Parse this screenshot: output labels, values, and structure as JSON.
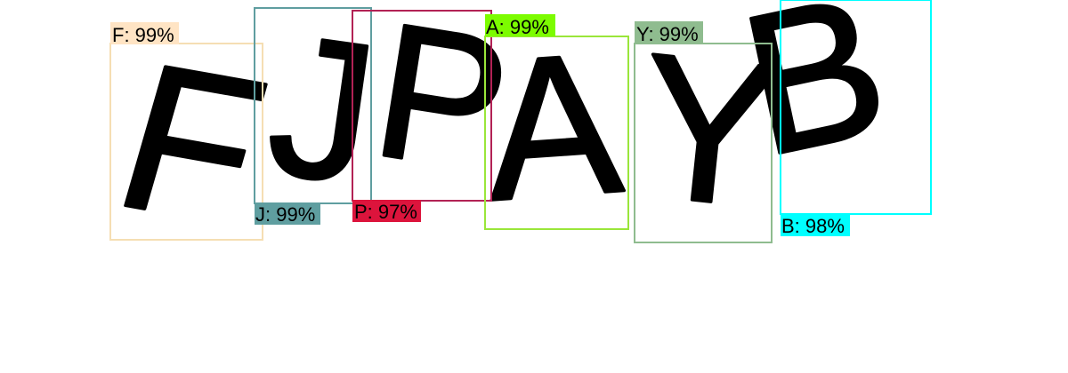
{
  "detections": [
    {
      "glyph": "F",
      "label": "F: 99%",
      "box_color": "#F5DEB3",
      "label_bg": "#FFE4C4"
    },
    {
      "glyph": "J",
      "label": "J: 99%",
      "box_color": "#5F9EA0",
      "label_bg": "#5F9EA0"
    },
    {
      "glyph": "P",
      "label": "P: 97%",
      "box_color": "#B22255",
      "label_bg": "#DC143C"
    },
    {
      "glyph": "A",
      "label": "A: 99%",
      "box_color": "#9AE63A",
      "label_bg": "#7CFC00"
    },
    {
      "glyph": "Y",
      "label": "Y: 99%",
      "box_color": "#8FBC8F",
      "label_bg": "#8FBC8F"
    },
    {
      "glyph": "B",
      "label": "B: 98%",
      "box_color": "#00FFFF",
      "label_bg": "#00FFFF"
    }
  ]
}
